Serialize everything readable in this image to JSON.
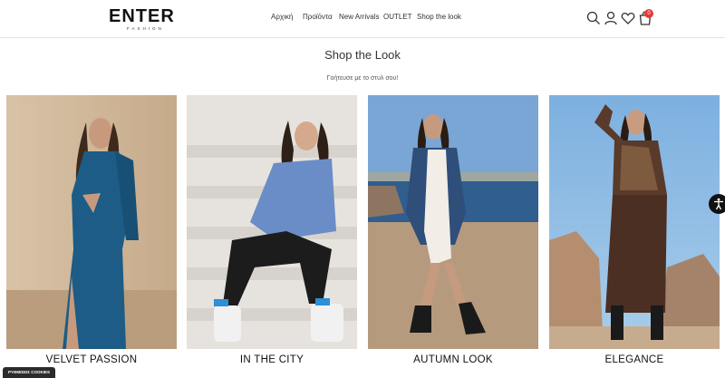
{
  "brand": {
    "name": "ENTER",
    "tagline": "FASHION"
  },
  "nav": {
    "items": [
      "Αρχική",
      "Προϊόντα",
      "New Arrivals",
      "OUTLET",
      "Shop the look"
    ]
  },
  "header_icons": [
    "search-icon",
    "user-icon",
    "heart-icon",
    "cart-icon"
  ],
  "cart": {
    "count": "0"
  },
  "page": {
    "title": "Shop the Look",
    "subtitle": "Γοήτευσε με το στυλ σου!"
  },
  "looks": [
    {
      "label": "VELVET PASSION"
    },
    {
      "label": "IN THE CITY"
    },
    {
      "label": "AUTUMN LOOK"
    },
    {
      "label": "ELEGANCE"
    }
  ],
  "cookies": {
    "label": "ΡΥΘΜΙΣΕΙΣ COOKIES"
  },
  "colors": {
    "accent": "#e53935",
    "text": "#222222"
  }
}
